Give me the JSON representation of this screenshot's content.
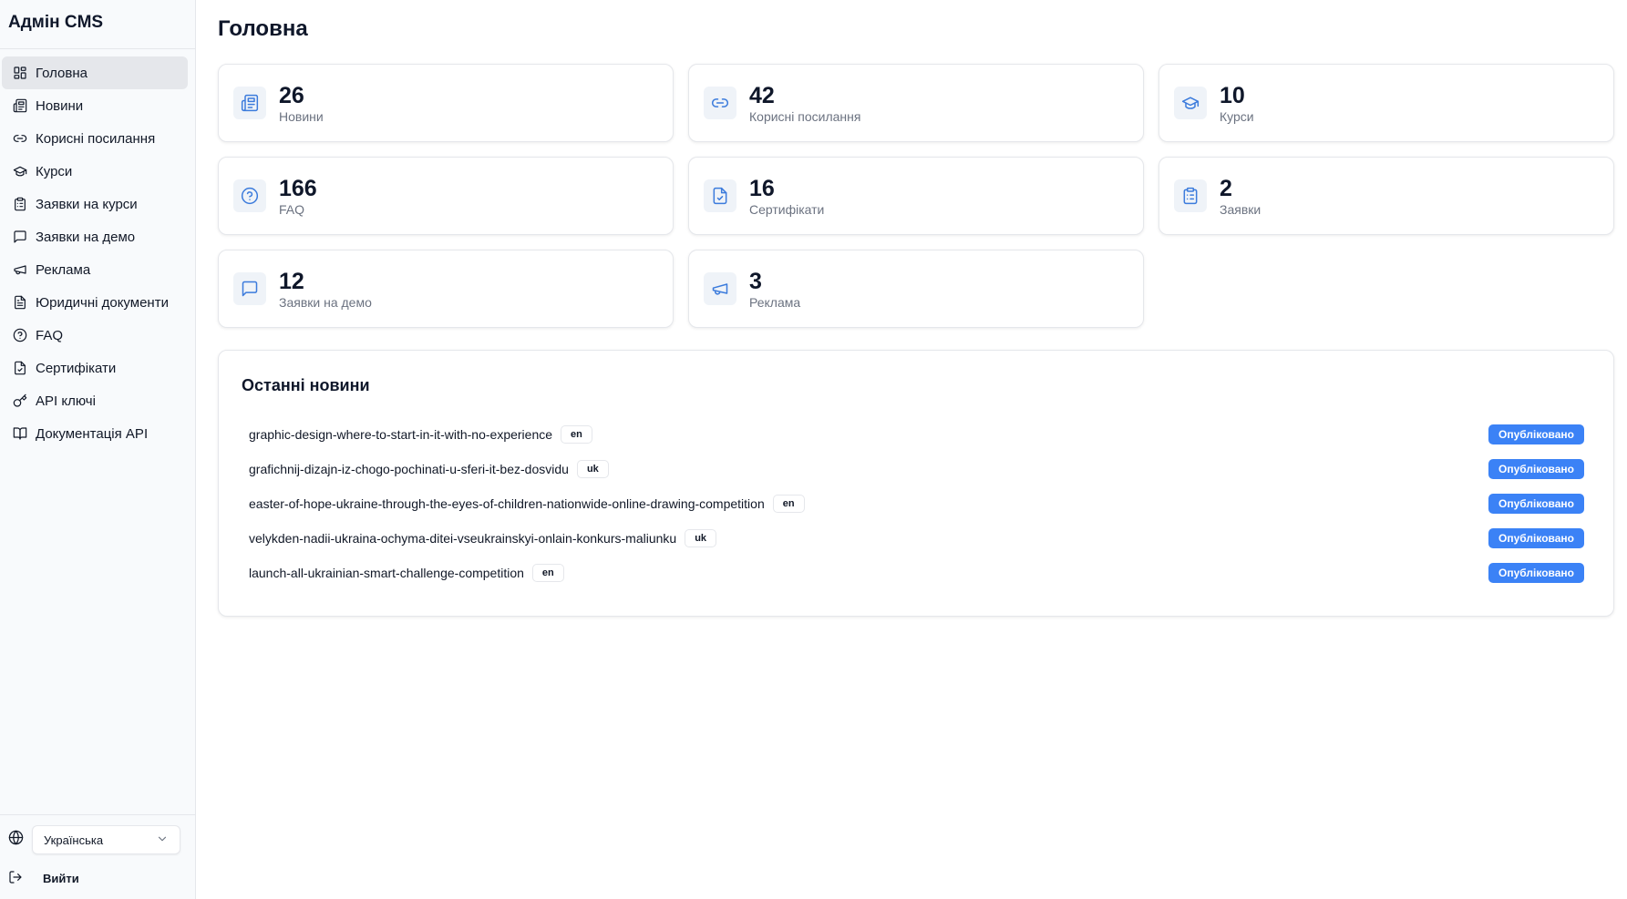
{
  "sidebar": {
    "brand": "Адмін CMS",
    "items": [
      {
        "label": "Головна",
        "icon": "dashboard-icon",
        "active": true
      },
      {
        "label": "Новини",
        "icon": "newspaper-icon"
      },
      {
        "label": "Корисні посилання",
        "icon": "link-icon"
      },
      {
        "label": "Курси",
        "icon": "graduation-cap-icon"
      },
      {
        "label": "Заявки на курси",
        "icon": "clipboard-icon"
      },
      {
        "label": "Заявки на демо",
        "icon": "message-square-icon"
      },
      {
        "label": "Реклама",
        "icon": "megaphone-icon"
      },
      {
        "label": "Юридичні документи",
        "icon": "file-text-icon"
      },
      {
        "label": "FAQ",
        "icon": "help-circle-icon"
      },
      {
        "label": "Сертифікати",
        "icon": "file-check-icon"
      },
      {
        "label": "API ключі",
        "icon": "key-icon"
      },
      {
        "label": "Документація API",
        "icon": "book-open-icon"
      }
    ],
    "language": {
      "selected": "Українська"
    },
    "logout_label": "Вийти"
  },
  "main": {
    "title": "Головна",
    "stats": [
      {
        "value": "26",
        "label": "Новини",
        "icon": "newspaper-icon"
      },
      {
        "value": "42",
        "label": "Корисні посилання",
        "icon": "link-icon"
      },
      {
        "value": "10",
        "label": "Курси",
        "icon": "graduation-cap-icon"
      },
      {
        "value": "166",
        "label": "FAQ",
        "icon": "help-circle-icon"
      },
      {
        "value": "16",
        "label": "Сертифікати",
        "icon": "file-check-icon"
      },
      {
        "value": "2",
        "label": "Заявки",
        "icon": "clipboard-icon"
      },
      {
        "value": "12",
        "label": "Заявки на демо",
        "icon": "message-square-icon"
      },
      {
        "value": "3",
        "label": "Реклама",
        "icon": "megaphone-icon"
      }
    ],
    "news": {
      "title": "Останні новини",
      "items": [
        {
          "slug": "graphic-design-where-to-start-in-it-with-no-experience",
          "lang": "en",
          "status": "Опубліковано"
        },
        {
          "slug": "grafichnij-dizajn-iz-chogo-pochinati-u-sferi-it-bez-dosvidu",
          "lang": "uk",
          "status": "Опубліковано"
        },
        {
          "slug": "easter-of-hope-ukraine-through-the-eyes-of-children-nationwide-online-drawing-competition",
          "lang": "en",
          "status": "Опубліковано"
        },
        {
          "slug": "velykden-nadii-ukraina-ochyma-ditei-vseukrainskyi-onlain-konkurs-maliunku",
          "lang": "uk",
          "status": "Опубліковано"
        },
        {
          "slug": "launch-all-ukrainian-smart-challenge-competition",
          "lang": "en",
          "status": "Опубліковано"
        }
      ]
    }
  },
  "colors": {
    "accent": "#3b82f6",
    "icon": "#3b7bdc",
    "sidebar_bg": "#f8fafc"
  }
}
